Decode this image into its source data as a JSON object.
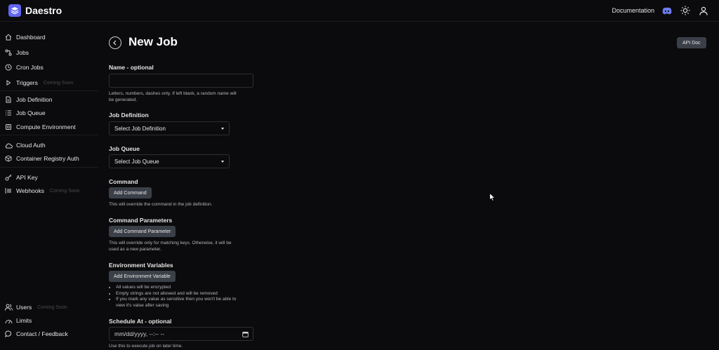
{
  "app": {
    "name": "Daestro"
  },
  "topbar": {
    "documentation": "Documentation"
  },
  "sidebar": {
    "items": [
      {
        "label": "Dashboard",
        "icon": "home-icon"
      },
      {
        "label": "Jobs",
        "icon": "jobs-icon"
      },
      {
        "label": "Cron Jobs",
        "icon": "clock-icon"
      },
      {
        "label": "Triggers",
        "icon": "play-icon",
        "badge": "Coming Soon"
      },
      {
        "label": "Job Definition",
        "icon": "document-icon"
      },
      {
        "label": "Job Queue",
        "icon": "list-icon"
      },
      {
        "label": "Compute Environment",
        "icon": "chip-icon"
      },
      {
        "label": "Cloud Auth",
        "icon": "cloud-icon"
      },
      {
        "label": "Container Registry Auth",
        "icon": "box-icon"
      },
      {
        "label": "API Key",
        "icon": "key-icon"
      },
      {
        "label": "Webhooks",
        "icon": "webhook-icon",
        "badge": "Coming Soon"
      }
    ],
    "bottom": [
      {
        "label": "Users",
        "icon": "users-icon",
        "badge": "Coming Soon"
      },
      {
        "label": "Limits",
        "icon": "gauge-icon"
      },
      {
        "label": "Contact / Feedback",
        "icon": "chat-icon"
      }
    ]
  },
  "page": {
    "title": "New Job",
    "api_doc": "API Doc"
  },
  "form": {
    "name": {
      "label": "Name - optional",
      "value": "",
      "help": "Letters, numbers, dashes only. If left blank, a random name will be generated."
    },
    "job_definition": {
      "label": "Job Definition",
      "selected": "Select Job Definition"
    },
    "job_queue": {
      "label": "Job Queue",
      "selected": "Select Job Queue"
    },
    "command": {
      "label": "Command",
      "button": "Add Command",
      "help": "This will override the command in the job definition."
    },
    "command_parameters": {
      "label": "Command Parameters",
      "button": "Add Command Parameter",
      "help": "This will override only for matching keys. Otherwise, it will be used as a new parameter."
    },
    "environment_variables": {
      "label": "Environment Variables",
      "button": "Add Environment Variable",
      "notes": [
        "All values will be encrypted",
        "Empty strings are not allowed and will be removed",
        "If you mark any value as sensitive then you won't be able to view it's value after saving"
      ]
    },
    "schedule_at": {
      "label": "Schedule At - optional",
      "placeholder": "mm/dd/yyyy, --:-- --",
      "help": "Use this to execute job on later time."
    }
  },
  "colors": {
    "background": "#0b0b0d",
    "accent": "#6366f1",
    "button": "#3a3f48"
  }
}
